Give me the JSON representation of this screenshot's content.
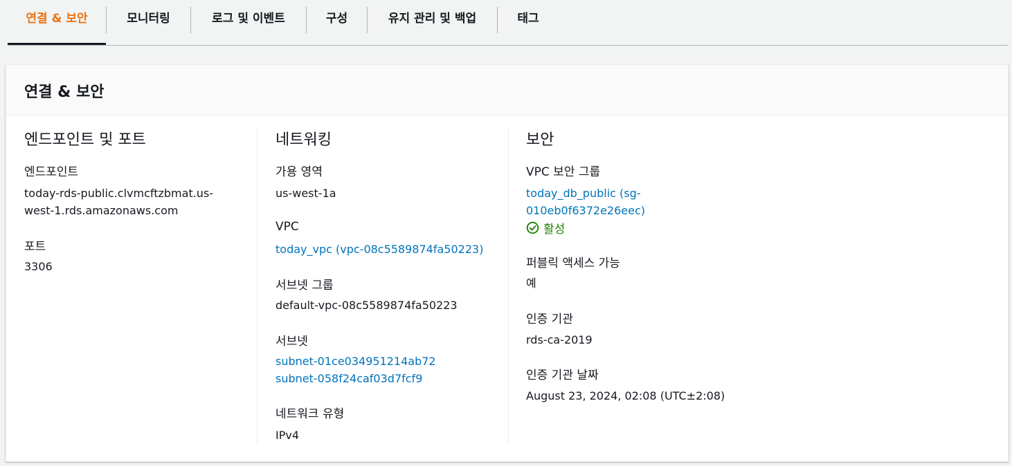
{
  "tabs": [
    {
      "label": "연결 & 보안",
      "active": true
    },
    {
      "label": "모니터링"
    },
    {
      "label": "로그 및 이벤트"
    },
    {
      "label": "구성"
    },
    {
      "label": "유지 관리 및 백업"
    },
    {
      "label": "태그"
    }
  ],
  "panel": {
    "title": "연결 & 보안",
    "endpoint_port": {
      "title": "엔드포인트 및 포트",
      "endpoint_label": "엔드포인트",
      "endpoint_line1": "today-rds-public.clvmcftzbmat.us-",
      "endpoint_line2": "west-1.rds.amazonaws.com",
      "port_label": "포트",
      "port_value": "3306"
    },
    "networking": {
      "title": "네트워킹",
      "az_label": "가용 영역",
      "az_value": "us-west-1a",
      "vpc_label": "VPC",
      "vpc_value": "today_vpc (vpc-08c5589874fa50223)",
      "subnet_group_label": "서브넷 그룹",
      "subnet_group_value": "default-vpc-08c5589874fa50223",
      "subnets_label": "서브넷",
      "subnets": [
        "subnet-01ce034951214ab72",
        "subnet-058f24caf03d7fcf9"
      ],
      "network_type_label": "네트워크 유형",
      "network_type_value": "IPv4"
    },
    "security": {
      "title": "보안",
      "sg_label": "VPC 보안 그룹",
      "sg_line1": "today_db_public (sg-",
      "sg_line2": "010eb0f6372e26eec)",
      "sg_status": "활성",
      "public_label": "퍼블릭 액세스 가능",
      "public_value": "예",
      "ca_label": "인증 기관",
      "ca_value": "rds-ca-2019",
      "ca_date_label": "인증 기관 날짜",
      "ca_date_value": "August 23, 2024, 02:08 (UTC±2:08)"
    }
  },
  "colors": {
    "accent": "#ec7211",
    "link": "#0073bb",
    "success": "#1d8102"
  },
  "icons": {
    "status": "check-circle-icon"
  }
}
